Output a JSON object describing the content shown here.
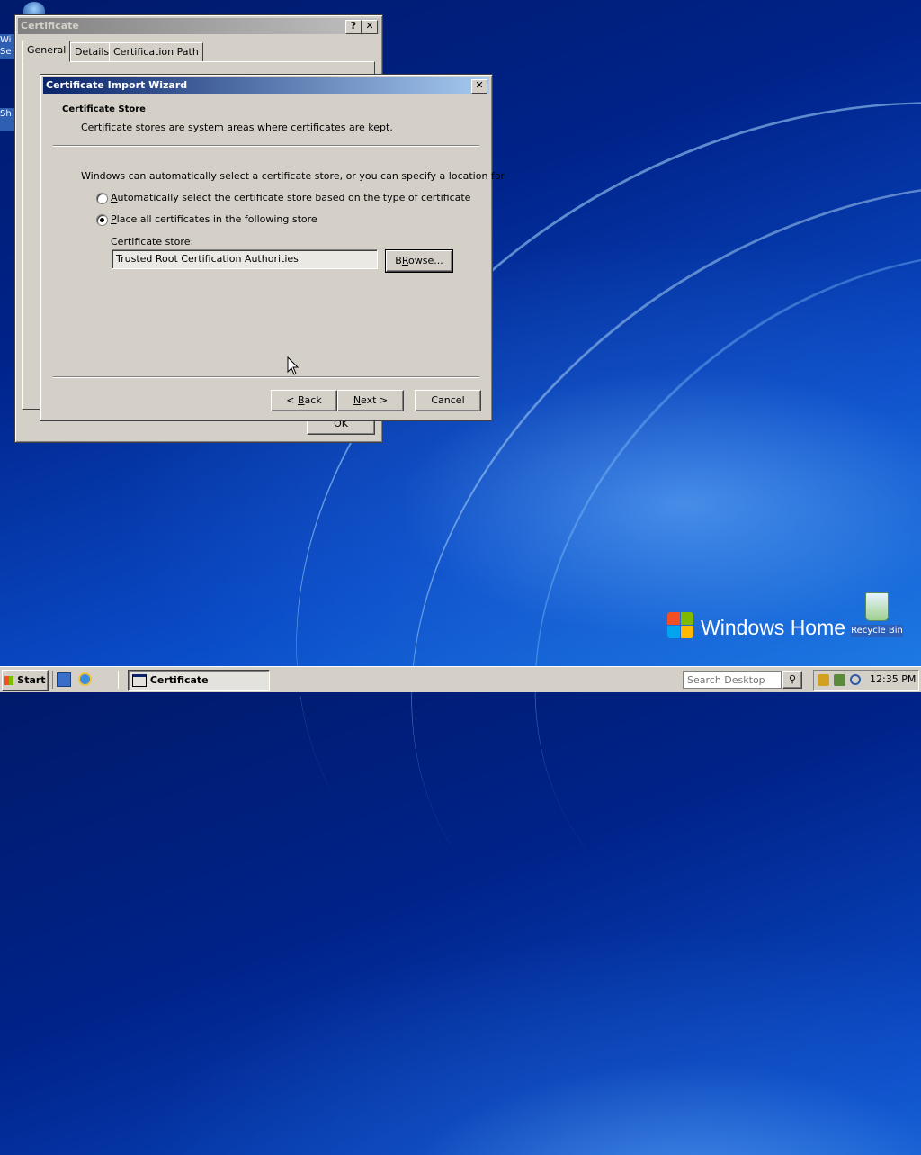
{
  "desktop": {
    "left_icon_labels": [
      "Wi",
      "Se",
      "Sh"
    ],
    "brand_text": "Windows Home S",
    "recycle_bin_label": "Recycle Bin"
  },
  "cert_window": {
    "title": "Certificate",
    "help_glyph": "?",
    "close_glyph": "✕",
    "tabs": [
      "General",
      "Details",
      "Certification Path"
    ],
    "ok_label": "OK"
  },
  "wizard": {
    "title": "Certificate Import Wizard",
    "close_glyph": "✕",
    "heading": "Certificate Store",
    "subheading": "Certificate stores are system areas where certificates are kept.",
    "intro": "Windows can automatically select a certificate store, or you can specify a location for",
    "options": [
      {
        "label_prefix": "",
        "label_key": "A",
        "label_rest": "utomatically select the certificate store based on the type of certificate",
        "selected": false
      },
      {
        "label_prefix": "",
        "label_key": "P",
        "label_rest": "lace all certificates in the following store",
        "selected": true
      }
    ],
    "store_label": "Certificate store:",
    "store_value": "Trusted Root Certification Authorities",
    "browse_key": "R",
    "browse_pre": "B",
    "browse_rest": "owse...",
    "back_pre": "< ",
    "back_key": "B",
    "back_rest": "ack",
    "next_key": "N",
    "next_rest": "ext >",
    "cancel_label": "Cancel"
  },
  "taskbar": {
    "start_label": "Start",
    "task_button_label": "Certificate",
    "search_placeholder": "Search Desktop",
    "clock": "12:35 PM"
  }
}
